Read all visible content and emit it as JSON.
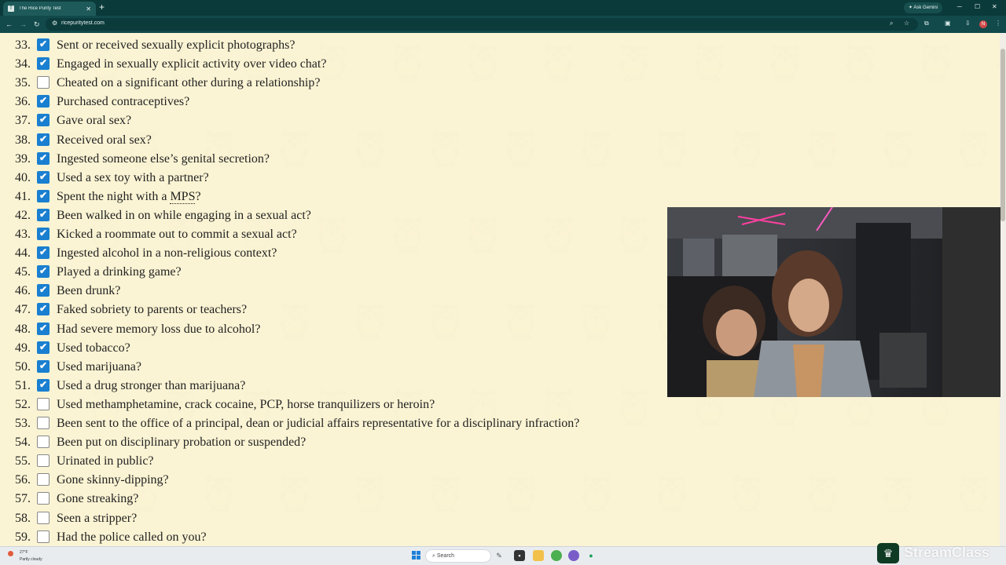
{
  "browser": {
    "tab_title": "The Rice Purity Test",
    "tab_favicon": "T",
    "url": "ricepuritytest.com",
    "ask_gemini": "Ask Gemini",
    "profile_initial": "N"
  },
  "questions": [
    {
      "num": "33.",
      "text": "Sent or received sexually explicit photographs?",
      "checked": true
    },
    {
      "num": "34.",
      "text": "Engaged in sexually explicit activity over video chat?",
      "checked": true
    },
    {
      "num": "35.",
      "text": "Cheated on a significant other during a relationship?",
      "checked": false
    },
    {
      "num": "36.",
      "text": "Purchased contraceptives?",
      "checked": true
    },
    {
      "num": "37.",
      "text": "Gave oral sex?",
      "checked": true
    },
    {
      "num": "38.",
      "text": "Received oral sex?",
      "checked": true
    },
    {
      "num": "39.",
      "text": "Ingested someone else’s genital secretion?",
      "checked": true
    },
    {
      "num": "40.",
      "text": "Used a sex toy with a partner?",
      "checked": true
    },
    {
      "num": "41.",
      "text": "Spent the night with a MPS?",
      "checked": true
    },
    {
      "num": "42.",
      "text": "Been walked in on while engaging in a sexual act?",
      "checked": true
    },
    {
      "num": "43.",
      "text": "Kicked a roommate out to commit a sexual act?",
      "checked": true
    },
    {
      "num": "44.",
      "text": "Ingested alcohol in a non-religious context?",
      "checked": true
    },
    {
      "num": "45.",
      "text": "Played a drinking game?",
      "checked": true
    },
    {
      "num": "46.",
      "text": "Been drunk?",
      "checked": true
    },
    {
      "num": "47.",
      "text": "Faked sobriety to parents or teachers?",
      "checked": true
    },
    {
      "num": "48.",
      "text": "Had severe memory loss due to alcohol?",
      "checked": true
    },
    {
      "num": "49.",
      "text": "Used tobacco?",
      "checked": true
    },
    {
      "num": "50.",
      "text": "Used marijuana?",
      "checked": true
    },
    {
      "num": "51.",
      "text": "Used a drug stronger than marijuana?",
      "checked": true
    },
    {
      "num": "52.",
      "text": "Used methamphetamine, crack cocaine, PCP, horse tranquilizers or heroin?",
      "checked": false
    },
    {
      "num": "53.",
      "text": "Been sent to the office of a principal, dean or judicial affairs representative for a disciplinary infraction?",
      "checked": false
    },
    {
      "num": "54.",
      "text": "Been put on disciplinary probation or suspended?",
      "checked": false
    },
    {
      "num": "55.",
      "text": "Urinated in public?",
      "checked": false
    },
    {
      "num": "56.",
      "text": "Gone skinny-dipping?",
      "checked": false
    },
    {
      "num": "57.",
      "text": "Gone streaking?",
      "checked": false
    },
    {
      "num": "58.",
      "text": "Seen a stripper?",
      "checked": false
    },
    {
      "num": "59.",
      "text": "Had the police called on you?",
      "checked": false
    }
  ],
  "taskbar": {
    "weather_temp": "27°F",
    "weather_desc": "Partly cloudy",
    "search_placeholder": "Search"
  },
  "overlay": {
    "brand": "StreamClass"
  },
  "colors": {
    "page_bg": "#fbf4d4",
    "checkbox_checked": "#1a7fd0",
    "chrome_dark": "#0b3a3a"
  }
}
